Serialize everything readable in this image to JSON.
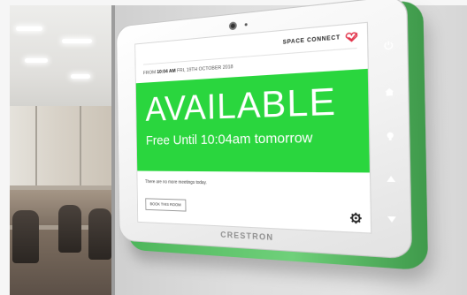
{
  "panel": {
    "brand": "SPACE CONNECT",
    "datetime_prefix": "FROM",
    "time": "10:04 AM",
    "date_rest": "FRI, 19TH OCTOBER 2018",
    "status": "AVAILABLE",
    "status_sub": "Free Until 10:04am tomorrow",
    "meetings_note": "There are no more meetings today.",
    "book_label": "BOOK THIS ROOM",
    "status_color": "#2ad63e"
  },
  "device": {
    "manufacturer": "CRESTRON",
    "accent": "#4cb55a"
  },
  "icons": {
    "logo": "heart-outline-icon",
    "settings": "gear-icon",
    "side_buttons": [
      "power-icon",
      "home-icon",
      "lightbulb-icon",
      "up-icon",
      "down-icon"
    ]
  }
}
